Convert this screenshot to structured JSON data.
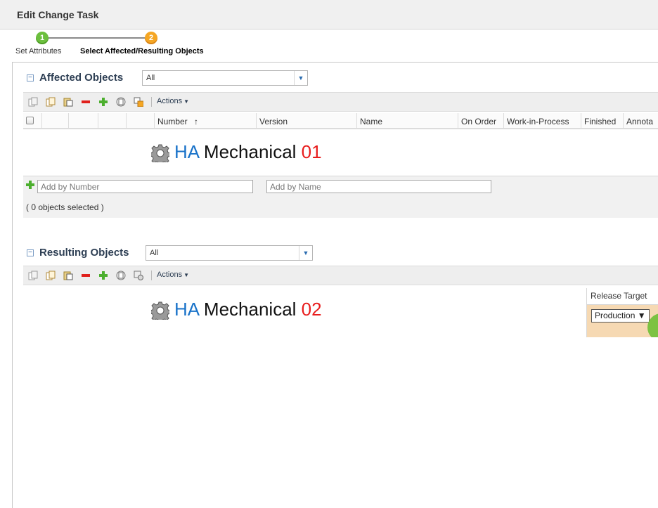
{
  "window": {
    "title": "Edit Change Task"
  },
  "wizard": {
    "steps": [
      {
        "number": "1",
        "label": "Set Attributes"
      },
      {
        "number": "2",
        "label": "Select Affected/Resulting Objects"
      }
    ]
  },
  "affected": {
    "title": "Affected Objects",
    "filter_value": "All",
    "toolbar_actions_label": "Actions",
    "columns": [
      "Number",
      "Version",
      "Name",
      "On Order",
      "Work-in-Process",
      "Finished",
      "Annota"
    ],
    "sort_indicator": "↑",
    "overlay": {
      "prefix": "HA",
      "middle": "Mechanical",
      "suffix": "01"
    },
    "add_by_number_placeholder": "Add by Number",
    "add_by_name_placeholder": "Add by Name",
    "selected_count": "( 0 objects selected )"
  },
  "resulting": {
    "title": "Resulting Objects",
    "filter_value": "All",
    "toolbar_actions_label": "Actions",
    "overlay": {
      "prefix": "HA",
      "middle": "Mechanical",
      "suffix": "02"
    },
    "release_target_header": "Release Target",
    "release_target_value": "Production ▼"
  },
  "colors": {
    "accent_blue": "#1a73c9",
    "accent_red": "#e81d1d",
    "step_complete": "#6cbf3e",
    "step_current": "#f5a623",
    "release_bg": "#f6d9b3"
  }
}
